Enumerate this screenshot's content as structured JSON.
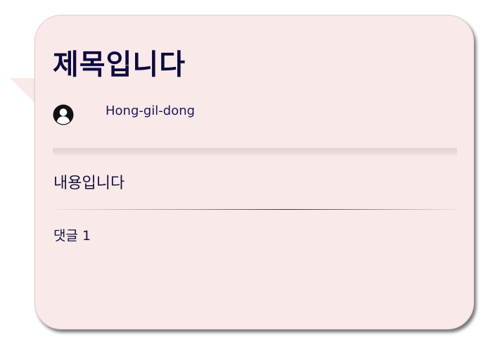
{
  "post": {
    "title": "제목입니다",
    "author": {
      "name": "Hong-gil-dong",
      "avatar_icon": "user-avatar-icon"
    },
    "content": "내용입니다",
    "comments_label": "댓글 1"
  },
  "colors": {
    "card_background": "#fae9e9",
    "title_text": "#0c0a3f",
    "body_text": "#14143d",
    "avatar": "#111111"
  }
}
